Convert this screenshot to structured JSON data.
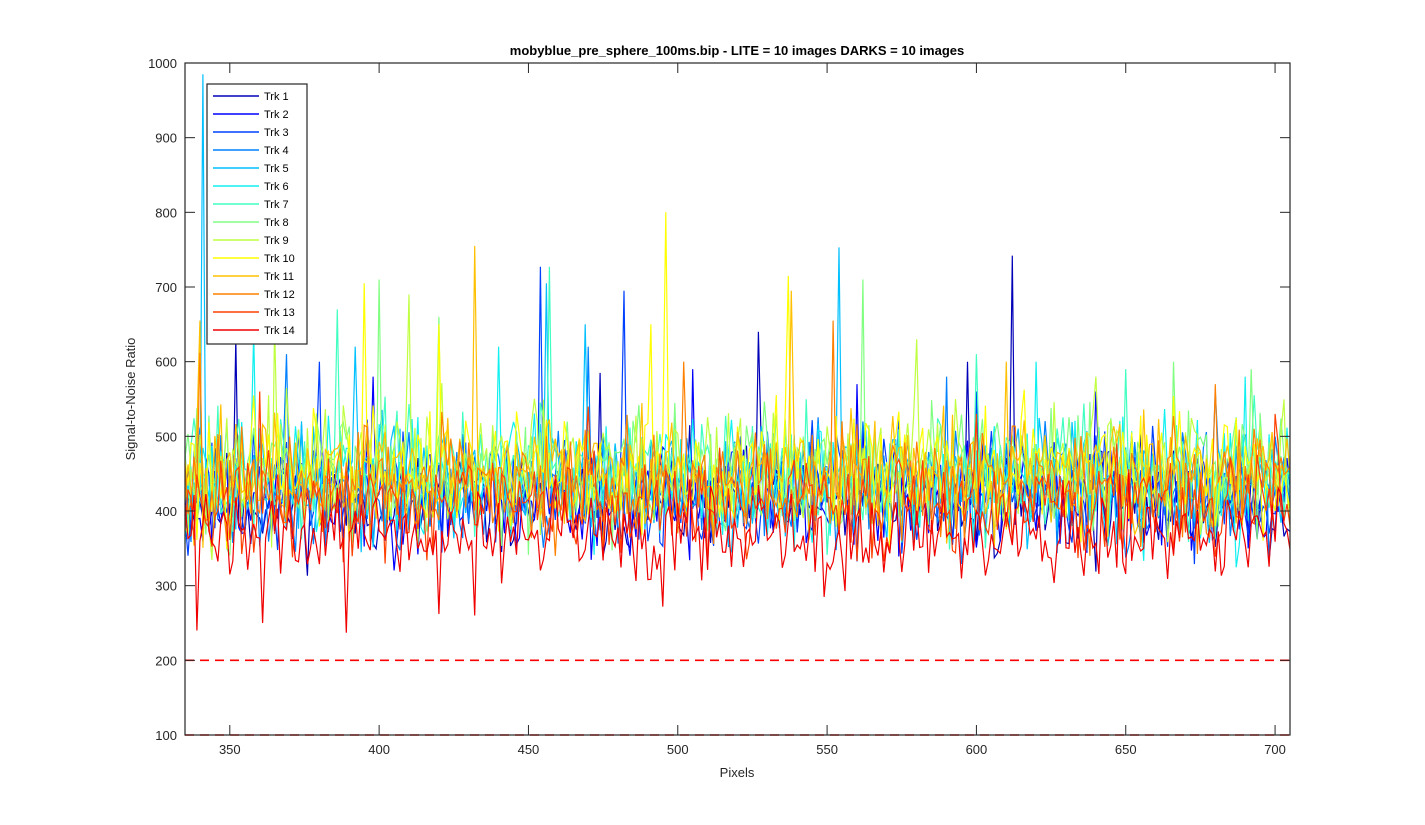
{
  "chart_data": {
    "type": "line",
    "title": "mobyblue_pre_sphere_100ms.bip - LITE =  10 images  DARKS = 10 images",
    "xlabel": "Pixels",
    "ylabel": "Signal-to-Noise Ratio",
    "xlim": [
      335,
      705
    ],
    "ylim": [
      100,
      1000
    ],
    "xticks": [
      350,
      400,
      450,
      500,
      550,
      600,
      650,
      700
    ],
    "yticks": [
      100,
      200,
      300,
      400,
      500,
      600,
      700,
      800,
      900,
      1000
    ],
    "grid": false,
    "legend_position": "top-left",
    "reference_lines": [
      {
        "y": 200,
        "style": "dashed",
        "color": "#ff0000"
      },
      {
        "y": 100,
        "style": "dashed",
        "color": "#ff0000"
      }
    ],
    "x": {
      "start": 335,
      "end": 705,
      "step": 1
    },
    "series": [
      {
        "name": "Trk 1",
        "color": "#0000b8",
        "base": 412,
        "noise": 48,
        "seed": 11,
        "spikes": [
          [
            352,
            630
          ],
          [
            527,
            640
          ],
          [
            612,
            742
          ],
          [
            597,
            600
          ],
          [
            474,
            585
          ]
        ]
      },
      {
        "name": "Trk 2",
        "color": "#0000ff",
        "base": 418,
        "noise": 50,
        "seed": 23,
        "spikes": [
          [
            398,
            580
          ],
          [
            505,
            590
          ],
          [
            560,
            570
          ],
          [
            640,
            560
          ]
        ]
      },
      {
        "name": "Trk 3",
        "color": "#0040ff",
        "base": 425,
        "noise": 50,
        "seed": 37,
        "spikes": [
          [
            454,
            727
          ],
          [
            482,
            695
          ],
          [
            380,
            600
          ],
          [
            600,
            560
          ]
        ]
      },
      {
        "name": "Trk 4",
        "color": "#0080ff",
        "base": 430,
        "noise": 52,
        "seed": 41,
        "spikes": [
          [
            369,
            610
          ],
          [
            470,
            620
          ],
          [
            590,
            580
          ],
          [
            680,
            560
          ]
        ]
      },
      {
        "name": "Trk 5",
        "color": "#00c0ff",
        "base": 438,
        "noise": 52,
        "seed": 53,
        "spikes": [
          [
            341,
            985
          ],
          [
            456,
            705
          ],
          [
            554,
            753
          ],
          [
            469,
            650
          ],
          [
            392,
            620
          ]
        ]
      },
      {
        "name": "Trk 6",
        "color": "#10f0f0",
        "base": 442,
        "noise": 55,
        "seed": 61,
        "spikes": [
          [
            358,
            640
          ],
          [
            440,
            620
          ],
          [
            620,
            600
          ],
          [
            690,
            580
          ]
        ]
      },
      {
        "name": "Trk 7",
        "color": "#40ffc0",
        "base": 448,
        "noise": 55,
        "seed": 73,
        "spikes": [
          [
            386,
            670
          ],
          [
            457,
            727
          ],
          [
            600,
            610
          ],
          [
            650,
            590
          ]
        ]
      },
      {
        "name": "Trk 8",
        "color": "#80ff80",
        "base": 452,
        "noise": 55,
        "seed": 83,
        "spikes": [
          [
            400,
            710
          ],
          [
            562,
            710
          ],
          [
            420,
            660
          ],
          [
            666,
            600
          ],
          [
            692,
            590
          ]
        ]
      },
      {
        "name": "Trk 9",
        "color": "#c0ff40",
        "base": 455,
        "noise": 55,
        "seed": 97,
        "spikes": [
          [
            365,
            650
          ],
          [
            410,
            690
          ],
          [
            580,
            630
          ],
          [
            640,
            580
          ]
        ]
      },
      {
        "name": "Trk 10",
        "color": "#ffff00",
        "base": 455,
        "noise": 55,
        "seed": 101,
        "spikes": [
          [
            395,
            705
          ],
          [
            496,
            800
          ],
          [
            537,
            715
          ],
          [
            491,
            650
          ],
          [
            420,
            650
          ]
        ]
      },
      {
        "name": "Trk 11",
        "color": "#ffc000",
        "base": 450,
        "noise": 52,
        "seed": 113,
        "spikes": [
          [
            432,
            755
          ],
          [
            538,
            695
          ],
          [
            340,
            655
          ],
          [
            610,
            600
          ]
        ]
      },
      {
        "name": "Trk 12",
        "color": "#ff8000",
        "base": 435,
        "noise": 50,
        "seed": 127,
        "spikes": [
          [
            552,
            655
          ],
          [
            502,
            600
          ],
          [
            340,
            612
          ],
          [
            680,
            570
          ]
        ]
      },
      {
        "name": "Trk 13",
        "color": "#ff4000",
        "base": 410,
        "noise": 45,
        "seed": 131,
        "spikes": [
          [
            360,
            560
          ],
          [
            470,
            540
          ],
          [
            600,
            530
          ],
          [
            700,
            530
          ]
        ]
      },
      {
        "name": "Trk 14",
        "color": "#f00000",
        "base": 370,
        "noise": 40,
        "seed": 139,
        "spikes": [
          [
            339,
            240
          ],
          [
            389,
            237
          ],
          [
            361,
            250
          ],
          [
            432,
            260
          ],
          [
            495,
            272
          ],
          [
            549,
            285
          ],
          [
            420,
            262
          ]
        ]
      }
    ]
  }
}
